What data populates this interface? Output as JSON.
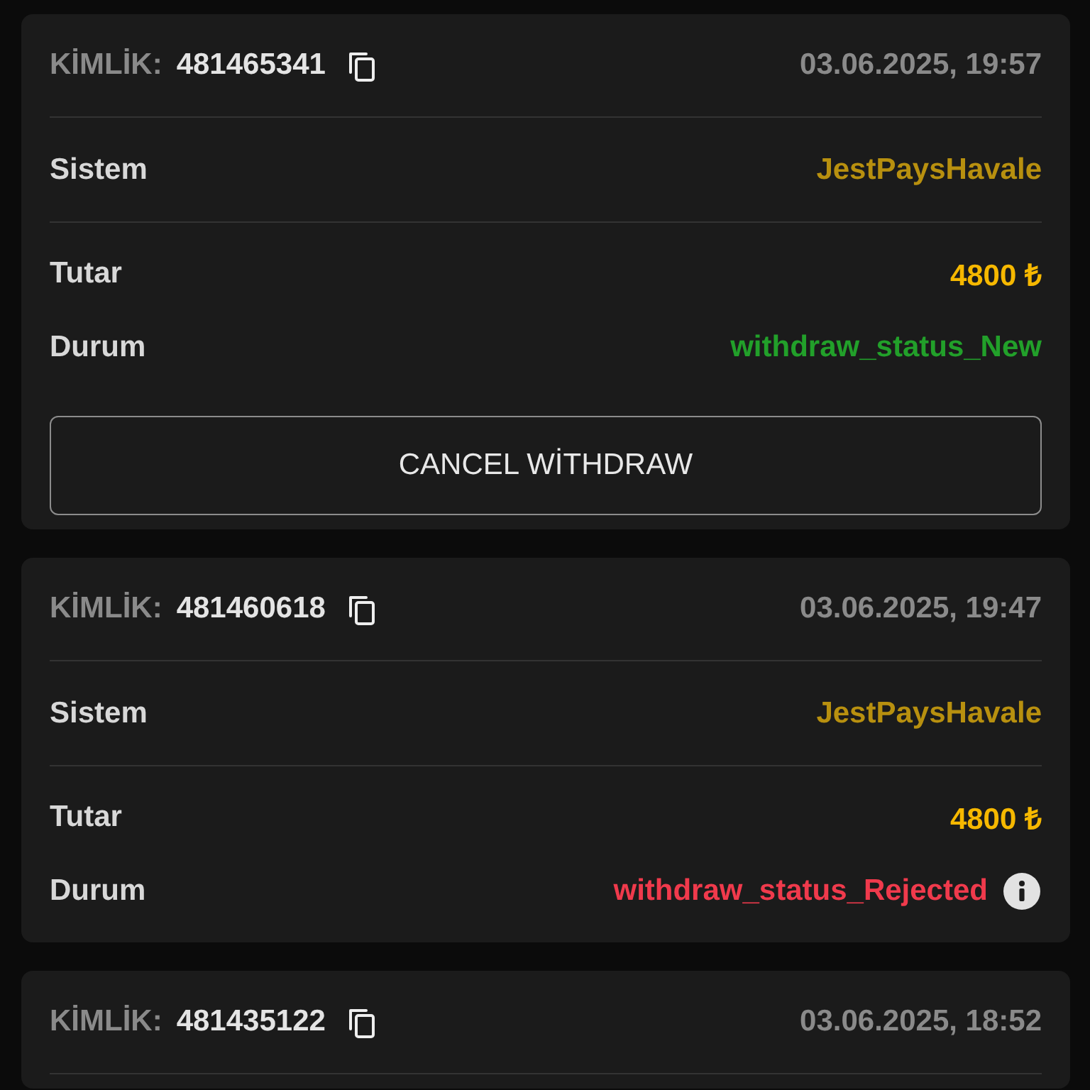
{
  "transactions": [
    {
      "id_label": "KİMLİK:",
      "id": "481465341",
      "date": "03.06.2025, 19:57",
      "rows": [
        {
          "kind": "system",
          "label": "Sistem",
          "value": "JestPaysHavale"
        },
        {
          "kind": "amount",
          "label": "Tutar",
          "value": "4800 ₺"
        },
        {
          "kind": "status",
          "label": "Durum",
          "value": "withdraw_status_New",
          "color": "#22a02a",
          "info": false
        }
      ],
      "button": "CANCEL WİTHDRAW"
    },
    {
      "id_label": "KİMLİK:",
      "id": "481460618",
      "date": "03.06.2025, 19:47",
      "rows": [
        {
          "kind": "system",
          "label": "Sistem",
          "value": "JestPaysHavale"
        },
        {
          "kind": "amount",
          "label": "Tutar",
          "value": "4800 ₺"
        },
        {
          "kind": "status",
          "label": "Durum",
          "value": "withdraw_status_Rejected",
          "color": "#f03a4c",
          "info": true
        }
      ]
    },
    {
      "id_label": "KİMLİK:",
      "id": "481435122",
      "date": "03.06.2025, 18:52"
    }
  ]
}
